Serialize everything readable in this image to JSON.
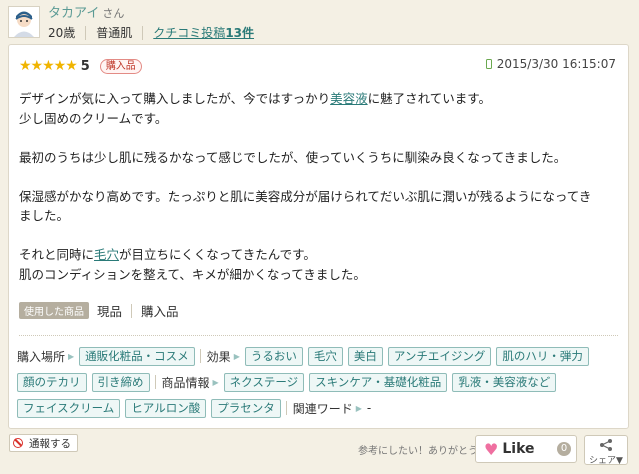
{
  "user": {
    "name": "タカアイ",
    "honorific": "さん",
    "age": "20歳",
    "skin_type": "普通肌",
    "review_count_prefix": "クチコミ投稿",
    "review_count": "13件"
  },
  "review": {
    "stars": "★★★★★",
    "score": "5",
    "purchase_badge": "購入品",
    "date": "2015/3/30 16:15:07",
    "body": {
      "l1a": "デザインが気に入って購入しましたが、今ではすっかり",
      "l1link": "美容液",
      "l1b": "に魅了されています。",
      "l2": "少し固めのクリームです。",
      "l3": "最初のうちは少し肌に残るかなって感じでしたが、使っていくうちに馴染み良くなってきました。",
      "l4": "保湿感がかなり高めです。たっぷりと肌に美容成分が届けられてだいぶ肌に潤いが残るようになってき",
      "l5": "ました。",
      "l6a": "それと同時に",
      "l6link": "毛穴",
      "l6b": "が目立ちにくくなってきたんです。",
      "l7": "肌のコンディションを整えて、キメが細かくなってきました。"
    },
    "used_label": "使用した商品",
    "used_items": [
      "現品",
      "購入品"
    ]
  },
  "tags": {
    "purchase_place_label": "購入場所",
    "purchase_place": [
      "通販化粧品・コスメ"
    ],
    "effect_label": "効果",
    "effects": [
      "うるおい",
      "毛穴",
      "美白",
      "アンチエイジング",
      "肌のハリ・弾力",
      "顔のテカリ",
      "引き締め"
    ],
    "product_info_label": "商品情報",
    "product_info": [
      "ネクステージ",
      "スキンケア・基礎化粧品",
      "乳液・美容液など",
      "フェイスクリーム",
      "ヒアルロン酸",
      "プラセンタ"
    ],
    "related_label": "関連ワード",
    "related_value": "-"
  },
  "footer": {
    "report_label": "通報する",
    "helpful_text": "参考にしたい！ありがとう",
    "like_label": "Like",
    "like_count": "0",
    "share_label": "シェア▼"
  }
}
